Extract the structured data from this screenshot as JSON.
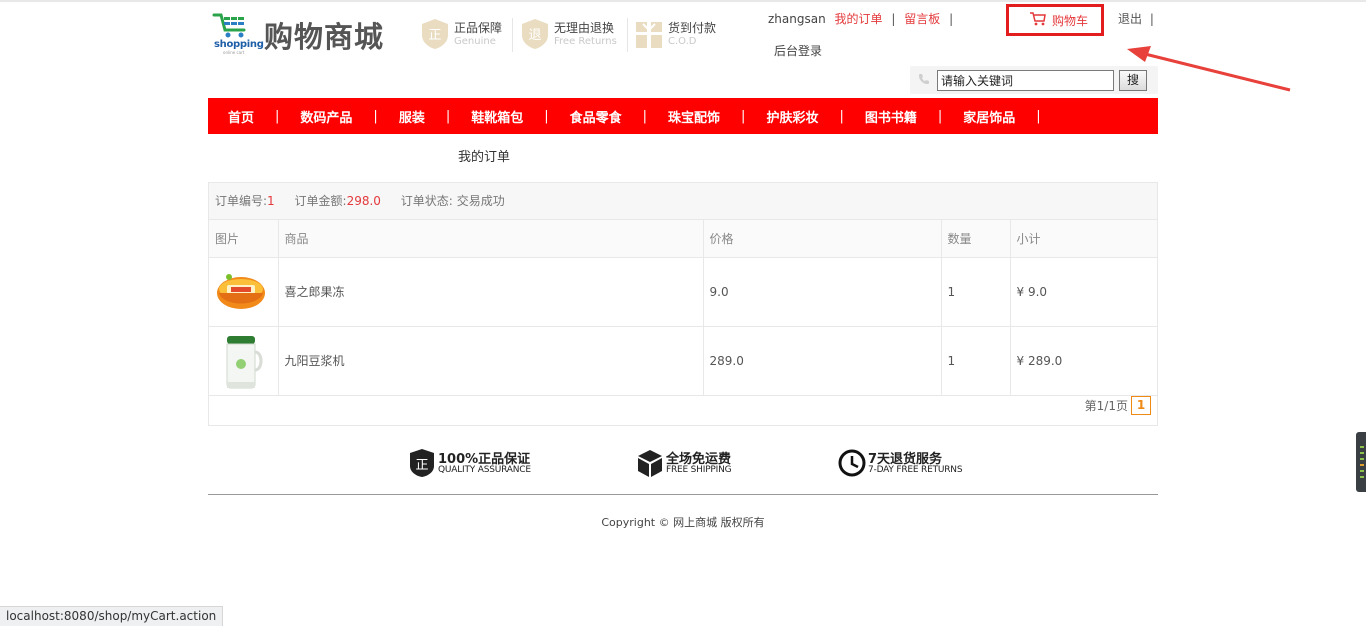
{
  "header": {
    "logo_en": "shopping",
    "logo_sub": "online cart",
    "logo_cn": "购物商城",
    "guarantees": [
      {
        "title": "正品保障",
        "subtitle": "Genuine",
        "icon": "seal-icon"
      },
      {
        "title": "无理由退换",
        "subtitle": "Free Returns",
        "icon": "return-icon"
      },
      {
        "title": "货到付款",
        "subtitle": "C.O.D",
        "icon": "gift-icon"
      }
    ],
    "username": "zhangsan",
    "my_orders": "我的订单",
    "message_board": "留言板",
    "separator": "|",
    "admin_login": "后台登录",
    "cart_label": "购物车",
    "logout": "退出",
    "search": {
      "value": "请输入关键词",
      "button": "搜"
    }
  },
  "nav": {
    "items": [
      "首页",
      "数码产品",
      "服装",
      "鞋靴箱包",
      "食品零食",
      "珠宝配饰",
      "护肤彩妆",
      "图书书籍",
      "家居饰品"
    ],
    "separator": "|"
  },
  "orders": {
    "title": "我的订单",
    "order_no_label": "订单编号:",
    "order_no": "1",
    "total_label": "订单金额:",
    "total": "298.0",
    "status_label": "订单状态:",
    "status": "交易成功",
    "columns": [
      "图片",
      "商品",
      "价格",
      "数量",
      "小计"
    ],
    "items": [
      {
        "name": "喜之郎果冻",
        "price": "9.0",
        "qty": "1",
        "subtotal": "¥ 9.0",
        "image": "jelly-cup-image"
      },
      {
        "name": "九阳豆浆机",
        "price": "289.0",
        "qty": "1",
        "subtotal": "¥ 289.0",
        "image": "soymilk-maker-image"
      }
    ],
    "pager_text": "第1/1页",
    "current_page": "1"
  },
  "services": [
    {
      "title": "100%正品保证",
      "subtitle": "QUALITY ASSURANCE",
      "icon": "shield-icon"
    },
    {
      "title": "全场免运费",
      "subtitle": "FREE SHIPPING",
      "icon": "box-icon"
    },
    {
      "title": "7天退货服务",
      "subtitle": "7-DAY FREE RETURNS",
      "icon": "clock-icon"
    }
  ],
  "footer": {
    "copyright": "Copyright © 网上商城 版权所有"
  },
  "statusbar": {
    "url": "localhost:8080/shop/myCart.action"
  },
  "colors": {
    "brand_red": "#ff0000",
    "accent_red": "#e4393c",
    "pager_orange": "#f08a16"
  }
}
